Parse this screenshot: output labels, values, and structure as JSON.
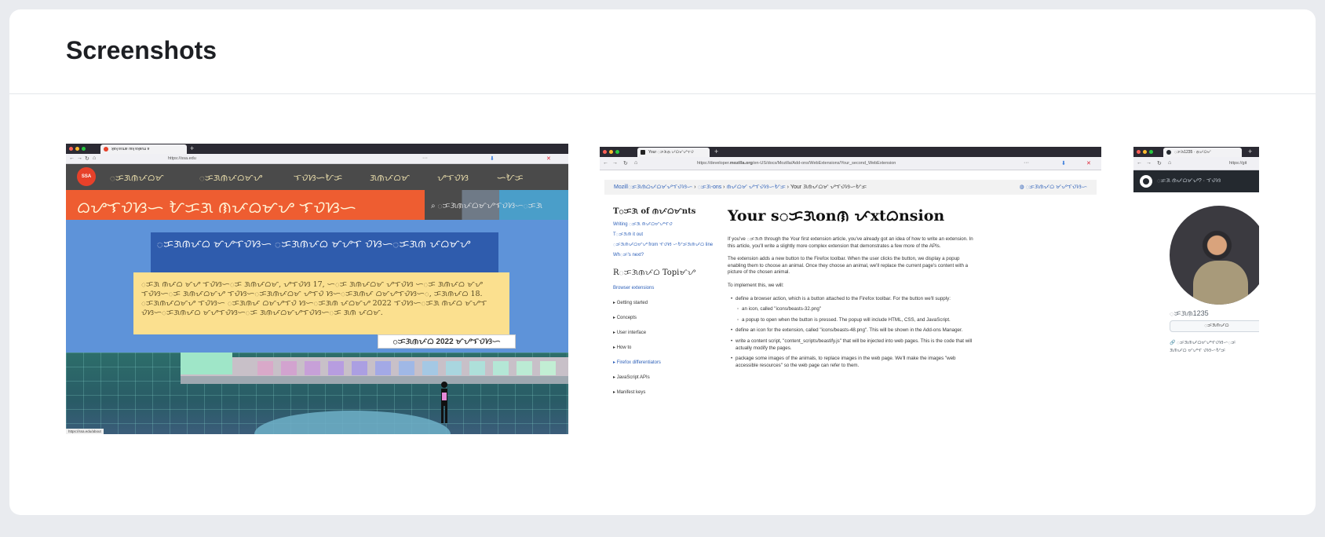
{
  "section": {
    "title": "Screenshots"
  },
  "screenshots": [
    {
      "tab_title": "ʞɐʞ ɐɾɯɐ ɾɐʞ ɐʞɐɾɯ ɐ",
      "url": "https://ssa.edu",
      "logo_text": "SSA NYC",
      "nav_items": [
        "ᜀᜃᜄᜈᜉᜊᜋ",
        "ᜀᜃᜄᜈᜉᜊᜋᜌ",
        "ᜎᜏᜐᜑᜀᜃ",
        "ᜄᜈᜉᜊᜋ",
        "ᜌᜎᜏᜐ",
        "ᜑᜀᜃ"
      ],
      "title": "ᜊᜌᜎᜏᜐᜑ ᜀᜃᜄ ᜈᜉᜊᜋᜌ ᜎᜏᜐᜑ",
      "search_placeholder": "ᜀᜃᜄᜈᜉᜊᜋᜌᜎᜏᜐᜑᜀᜃᜄ",
      "banner_text": "ᜀᜃᜄᜈᜉᜊ ᜋᜌᜎᜏᜐᜑ ᜀᜃᜄᜈᜉᜊ ᜋᜌᜎ ᜏᜐᜑᜀᜃᜄᜈ ᜉᜊᜋᜌ",
      "notice_text": "ᜀᜃᜄ ᜈᜉᜊ ᜋᜌ ᜎᜏᜐᜑᜀᜃ ᜄᜈᜉᜊᜋ, ᜌᜎᜏᜐ 17, ᜑᜀᜃ ᜄᜈᜉᜊᜋ ᜌᜎᜏᜐ ᜑᜀᜃ ᜄᜈᜉᜊ ᜋᜌ ᜎᜏᜐᜑᜀᜃ ᜄᜈᜉᜊᜋᜌ ᜎᜏᜐᜑᜀᜃᜄᜈᜉᜊᜋ ᜌᜎᜏ ᜐᜑᜀᜃᜄᜈᜉ ᜊᜋᜌᜎᜏᜐᜑᜀ, ᜃᜄᜈᜉᜊ 18. ᜀᜃᜄᜈᜉᜊᜋᜌ ᜎᜏᜐᜑ ᜀᜃᜄᜈᜉ ᜊᜋᜌᜎᜏ ᜐᜑᜀᜃᜄᜈ ᜉᜊᜋᜌ 2022 ᜎᜏᜐᜑᜀᜃᜄ ᜈᜉᜊ ᜋᜌᜎ ᜏᜐᜑᜀᜃᜄᜈᜉᜊ ᜋᜌᜎᜏᜐᜑᜀᜃ ᜄᜈᜉᜊᜋᜌᜎᜏᜐᜑᜀᜃ ᜄᜈ ᜉᜊᜋ.",
      "date_label": "ᜀᜃᜄᜈᜉᜊ 2022 ᜋᜌᜎᜏᜐᜑ",
      "status_url": "https://ssa.edu/about"
    },
    {
      "tab_title": "Your ᜀᜃᜄᜈ ᜉᜊᜋᜌᜎᜏ",
      "url_prefix": "https://developer.",
      "url_domain": "mozilla.org",
      "url_suffix": "/en-US/docs/Mozilla/Add-ons/WebExtensions/Your_second_WebExtension",
      "breadcrumb": [
        "Mozillᜀᜃᜄᜈᜊᜉᜊᜋᜌᜎᜏᜐᜑ",
        "ᜀᜃᜄ-ons",
        "ᜈᜉᜊᜋ ᜌᜎᜏᜐᜑᜀᜃ",
        "Your ᜄᜈᜉᜊᜋ ᜌᜎᜏᜐᜑᜀᜃ"
      ],
      "language": "ᜀᜃᜄᜈᜉᜊ ᜋᜌᜎᜏᜐᜑ",
      "toc_heading": "Tᜀᜃᜄ of ᜈᜉᜊᜋnts",
      "toc_links": [
        "Writing ᜀᜃᜄ ᜈᜉᜊᜋᜌᜎᜏ",
        "Tᜀᜃᜄᜈ it out",
        "ᜀᜃᜄᜈᜉᜊᜋᜌ from ᜎᜏᜐ ᜑᜀᜃᜄᜈᜉᜊ line",
        "Whᜀᜃ's next?"
      ],
      "related_heading": "Rᜀᜃᜄᜈᜉᜊ Topiᜋᜌ",
      "related_topics": [
        "Browser extensions",
        "Getting started",
        "Concepts",
        "User interface",
        "How to",
        "Firefox differentiators",
        "JavaScript APIs",
        "Manifest keys"
      ],
      "heading": "Your sᜀᜃᜄonᜈ ᜉxtᜊnsion",
      "paragraph_1": "If you've ᜀᜃᜄᜈ through the Your first extension article, you've already got an idea of how to write an extension. In this article, you'll write a slightly more complex extension that demonstrates a few more of the APIs.",
      "paragraph_2": "The extension adds a new button to the Firefox toolbar. When the user clicks the button, we display a popup enabling them to choose an animal. Once they choose an animal, we'll replace the current page's content with a picture of the chosen animal.",
      "paragraph_3": "To implement this, we will:",
      "list_items": [
        "define a browser action, which is a button attached to the Firefox toolbar. For the button we'll supply:",
        "an icon, called \"icons/beasts-32.png\"",
        "a popup to open when the button is pressed. The popup will include HTML, CSS, and JavaScript.",
        "define an icon for the extension, called \"icons/beasts-48.png\". This will be shown in the Add-ons Manager.",
        "write a content script, \"content_scripts/beastify.js\" that will be injected into web pages. This is the code that will actually modify the pages.",
        "package some images of the animals, to replace images in the web page. We'll make the images \"web accessible resources\" so the web page can refer to them."
      ]
    },
    {
      "tab_title": "ᜀᜃᜄ1235 · ᜈᜉᜊᜋ",
      "url": "https://git",
      "nav_text": "ᜀᜃᜄ ᜈᜉᜊᜋᜌ? · ᜎᜏᜐ",
      "username": "ᜀᜃᜄᜈ1235",
      "button_label": "ᜀᜃᜄᜈᜉᜊ",
      "meta_lines": [
        "ᜀᜃᜄᜈᜉᜊᜋᜌᜎᜏᜐᜑᜀᜃ",
        "ᜄᜈᜉᜊ ᜋᜌᜎ ᜏᜐᜑᜀᜃ"
      ]
    }
  ]
}
